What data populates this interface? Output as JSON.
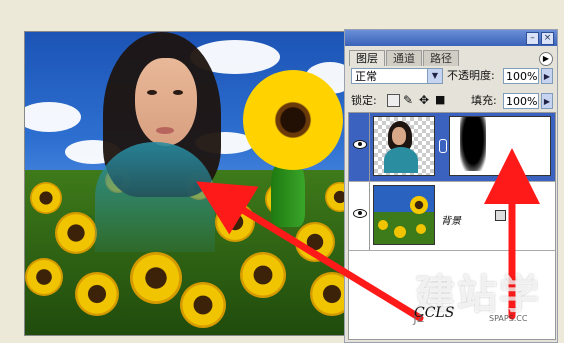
{
  "panel": {
    "tabs": [
      {
        "label": "图层",
        "active": true
      },
      {
        "label": "通道",
        "active": false
      },
      {
        "label": "路径",
        "active": false
      }
    ],
    "window_buttons": {
      "minimize": "–",
      "close": "×"
    },
    "blend_mode": "正常",
    "opacity_label": "不透明度:",
    "opacity_value": "100%",
    "lock_label": "锁定:",
    "fill_label": "填充:",
    "fill_value": "100%",
    "layers": [
      {
        "name": "",
        "selected": true,
        "has_mask": true
      },
      {
        "name": "背景",
        "selected": false,
        "has_mask": false
      }
    ]
  },
  "watermark": {
    "text": "建站学",
    "url": "jz",
    "logo_text": "SPAPS.CC"
  },
  "signature": "CCLS",
  "colors": {
    "panel_bg": "#e4e2d9",
    "selection": "#3c62c0",
    "titlebar": "#3a62b8",
    "arrow": "#ff1a1a"
  },
  "icons": [
    "eye-icon",
    "chain-link-icon",
    "lock-icon",
    "menu-arrow-icon",
    "brush-lock-icon",
    "move-lock-icon"
  ]
}
